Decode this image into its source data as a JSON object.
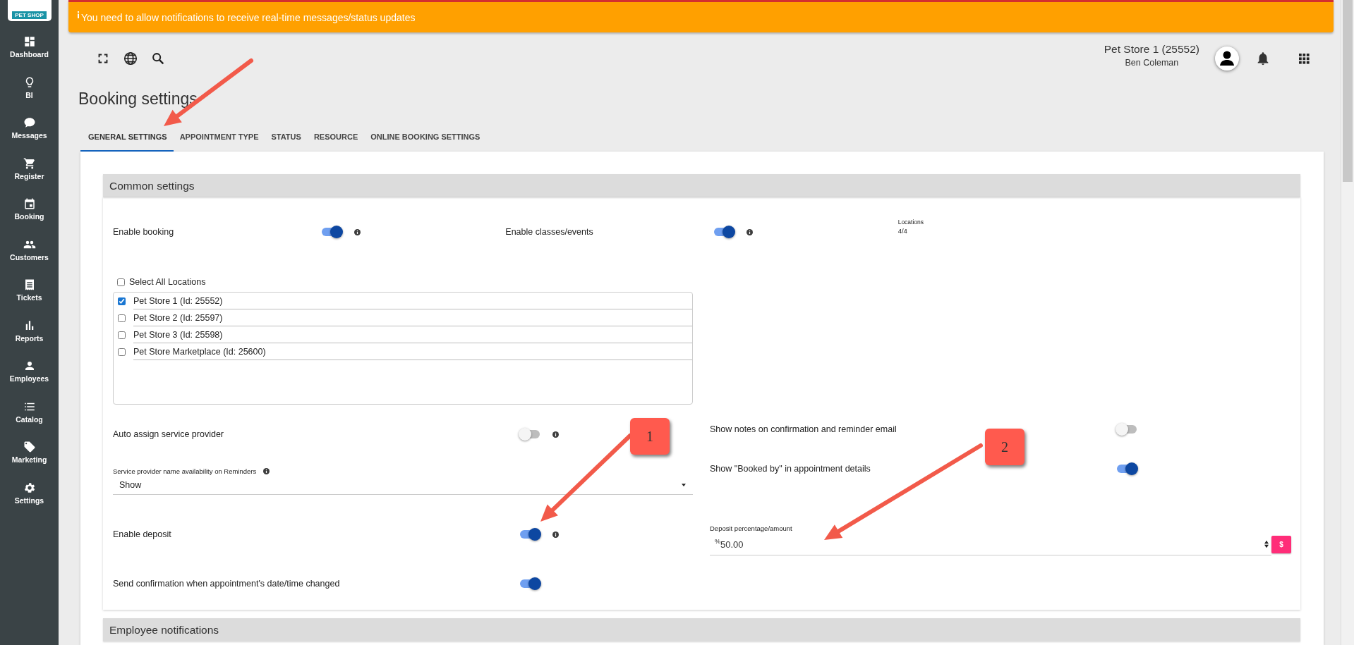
{
  "sidebar": {
    "logo": "PET SHOP",
    "items": [
      {
        "label": "Dashboard"
      },
      {
        "label": "BI"
      },
      {
        "label": "Messages"
      },
      {
        "label": "Register"
      },
      {
        "label": "Booking"
      },
      {
        "label": "Customers"
      },
      {
        "label": "Tickets"
      },
      {
        "label": "Reports"
      },
      {
        "label": "Employees"
      },
      {
        "label": "Catalog"
      },
      {
        "label": "Marketing"
      },
      {
        "label": "Settings"
      }
    ]
  },
  "banner": {
    "text": "You need to allow notifications to receive real-time messages/status updates"
  },
  "header": {
    "store": "Pet Store 1 (25552)",
    "user": "Ben Coleman"
  },
  "page_title": "Booking settings",
  "tabs": [
    {
      "label": "GENERAL SETTINGS",
      "selected": true
    },
    {
      "label": "APPOINTMENT TYPE",
      "selected": false
    },
    {
      "label": "STATUS",
      "selected": false
    },
    {
      "label": "RESOURCE",
      "selected": false
    },
    {
      "label": "ONLINE BOOKING SETTINGS",
      "selected": false
    }
  ],
  "common_settings": {
    "title": "Common settings",
    "top_row": [
      {
        "kind": "toggle",
        "label": "Enable booking",
        "on": true,
        "info": true
      },
      {
        "kind": "toggle",
        "label": "Enable classes/events",
        "on": true,
        "info": true
      },
      {
        "kind": "summary",
        "label": "Locations",
        "value": "4/4"
      }
    ],
    "locations": {
      "select_all": {
        "label": "Select All Locations",
        "checked": false
      },
      "items": [
        {
          "label": "Pet Store 1 (Id: 25552)",
          "checked": true
        },
        {
          "label": "Pet Store 2 (Id: 25597)",
          "checked": false
        },
        {
          "label": "Pet Store 3 (Id: 25598)",
          "checked": false
        },
        {
          "label": "Pet Store Marketplace (Id: 25600)",
          "checked": false
        }
      ]
    },
    "left_column": [
      {
        "kind": "toggle",
        "label": "Auto assign service provider",
        "on": false,
        "info": true
      },
      {
        "kind": "select",
        "label": "Service provider name availability on Reminders",
        "info": true,
        "value": "Show"
      },
      {
        "kind": "toggle",
        "label": "Enable deposit",
        "on": true,
        "info": true
      },
      {
        "kind": "toggle",
        "label": "Send confirmation when appointment's date/time changed",
        "on": true,
        "info": false
      }
    ],
    "right_column": [
      {
        "kind": "toggle",
        "label": "Show notes on confirmation and reminder email",
        "on": false,
        "info": false
      },
      {
        "kind": "toggle",
        "label": "Show \"Booked by\" in appointment details",
        "on": true,
        "info": false
      },
      {
        "kind": "number",
        "label": "Deposit percentage/amount",
        "prefix": "%",
        "value": "50.00",
        "unit_button": "$"
      }
    ]
  },
  "employee_notifications": {
    "title": "Employee notifications"
  },
  "annotations": [
    {
      "label": "1"
    },
    {
      "label": "2"
    }
  ]
}
